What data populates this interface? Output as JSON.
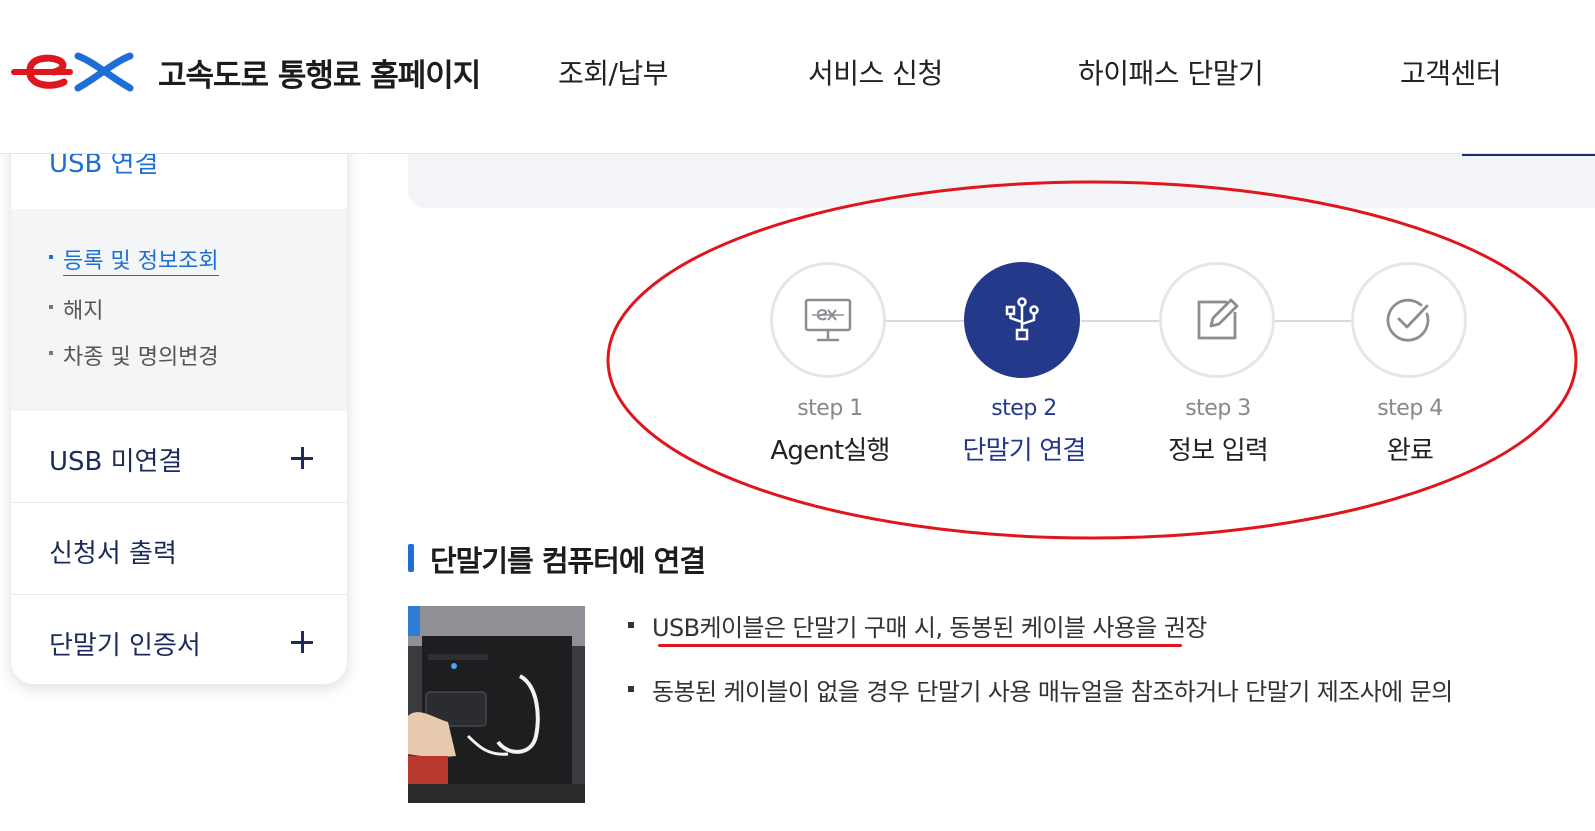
{
  "header": {
    "site_title": "고속도로 통행료 홈페이지",
    "nav": [
      "조회/납부",
      "서비스 신청",
      "하이패스 단말기",
      "고객센터"
    ]
  },
  "sidebar": {
    "open_menu": "USB 연결",
    "sub_items": [
      "등록 및 정보조회",
      "해지",
      "차종 및 명의변경"
    ],
    "active_sub": "등록 및 정보조회",
    "menus": [
      "USB 미연결",
      "신청서 출력",
      "단말기 인증서"
    ]
  },
  "steps": [
    {
      "num": "step 1",
      "name": "Agent실행",
      "icon": "monitor-ex-icon",
      "active": false
    },
    {
      "num": "step 2",
      "name": "단말기 연결",
      "icon": "usb-icon",
      "active": true
    },
    {
      "num": "step 3",
      "name": "정보 입력",
      "icon": "edit-icon",
      "active": false
    },
    {
      "num": "step 4",
      "name": "완료",
      "icon": "check-circle-icon",
      "active": false
    }
  ],
  "section": {
    "title": "단말기를 컴퓨터에 연결",
    "bullets": [
      "USB케이블은 단말기 구매 시, 동봉된 케이블 사용을 권장",
      "동봉된 케이블이 없을 경우 단말기 사용 매뉴얼을 참조하거나 단말기 제조사에 문의"
    ]
  },
  "colors": {
    "brand_red": "#e0161e",
    "brand_blue": "#1d6fd6",
    "step_active": "#24398a",
    "annotation_red": "#e0161e"
  }
}
